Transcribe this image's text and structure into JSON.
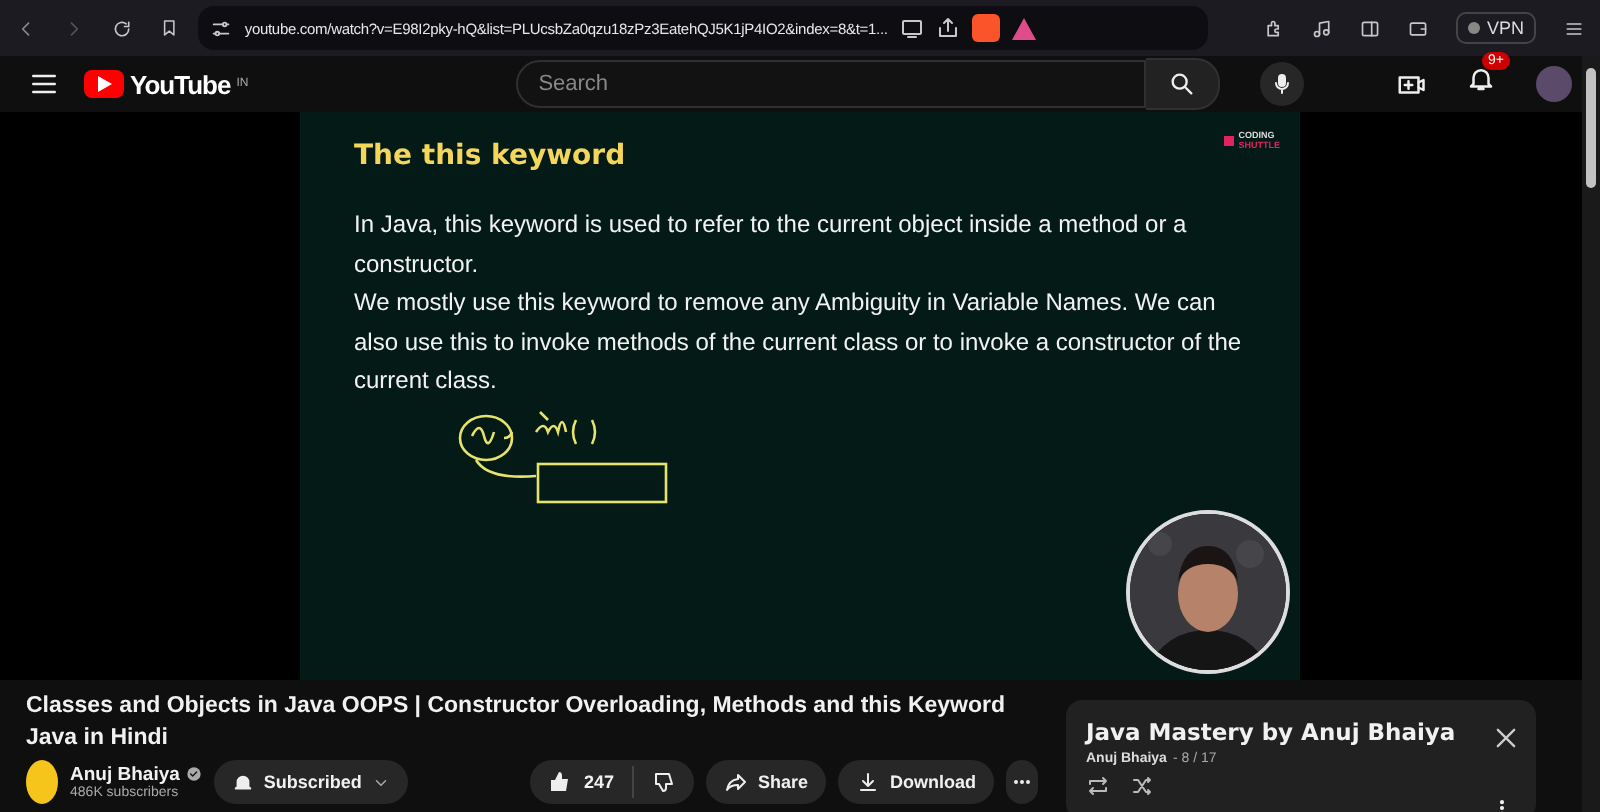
{
  "browser": {
    "url": "youtube.com/watch?v=E98I2pky-hQ&list=PLUcsbZa0qzu18zPz3EatehQJ5K1jP4IO2&index=8&t=1...",
    "vpn": "VPN"
  },
  "youtube": {
    "logo": "YouTube",
    "region": "IN",
    "search": {
      "placeholder": "Search"
    },
    "notifications": "9+"
  },
  "slide": {
    "title": "The this keyword",
    "brand": [
      "CODING",
      "SHUTTLE"
    ],
    "paragraphs": [
      "In Java, this keyword is used to refer to the current object inside a method or a constructor.",
      "We mostly use this keyword to remove any Ambiguity in Variable Names. We can also use this to invoke methods of the current class or to invoke a constructor of the current class."
    ]
  },
  "video": {
    "title": "Classes and Objects in Java OOPS | Constructor Overloading, Methods and this Keyword Java in Hindi",
    "channel": "Anuj Bhaiya",
    "subscribers": "486K subscribers",
    "subscribe": "Subscribed",
    "likes": "247",
    "actions": [
      {
        "kind": "share",
        "label": "Share"
      },
      {
        "kind": "download",
        "label": "Download"
      }
    ]
  },
  "playlist": {
    "title": "Java Mastery by Anuj Bhaiya",
    "owner": "Anuj Bhaiya",
    "position": "- 8 / 17"
  }
}
